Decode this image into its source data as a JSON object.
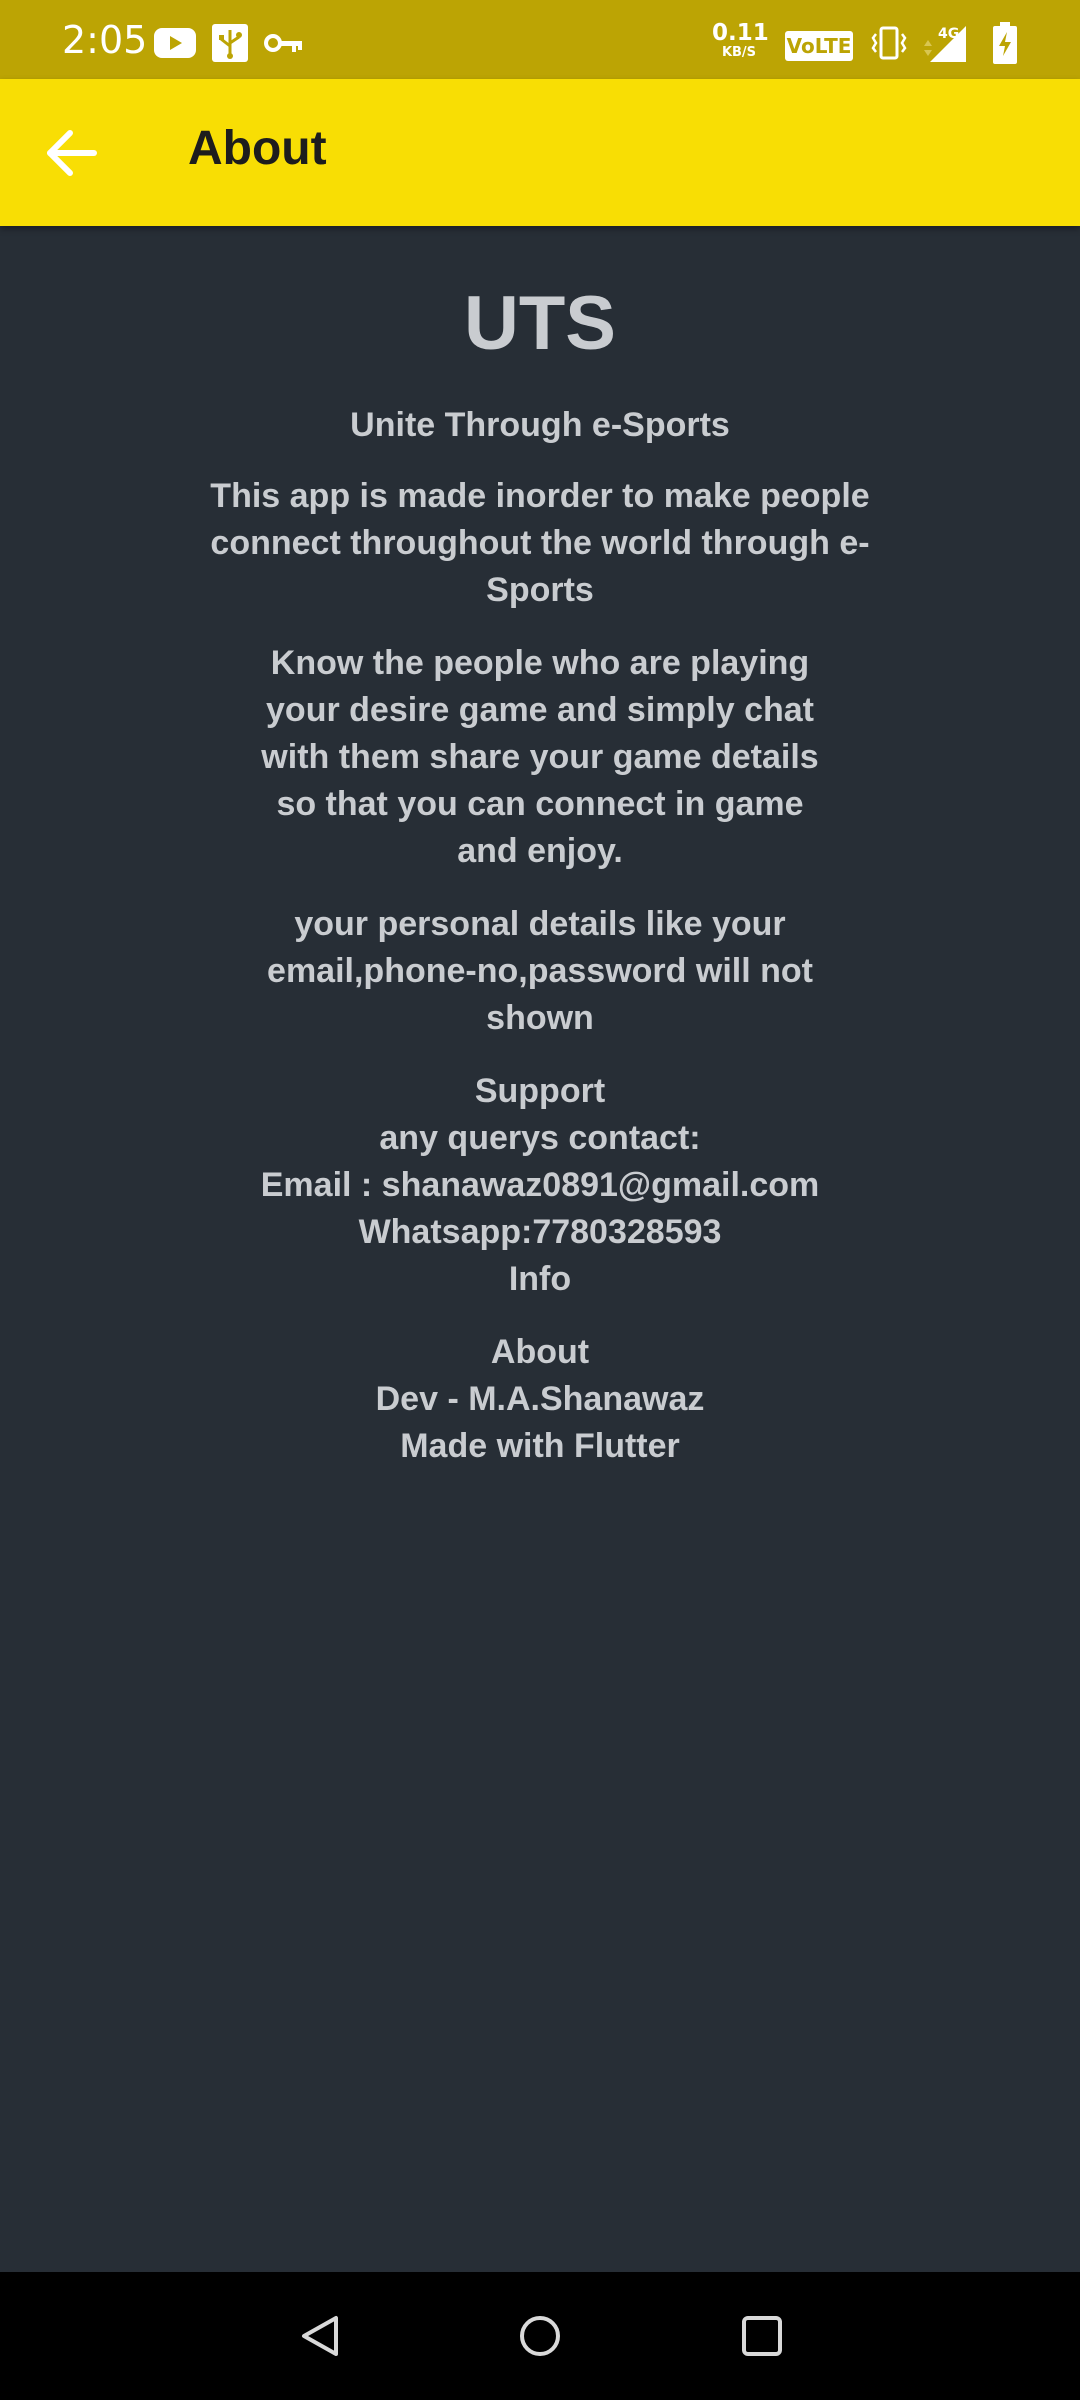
{
  "status_bar": {
    "time": "2:05",
    "net_speed_value": "0.11",
    "net_speed_unit": "KB/S",
    "volte": "VoLTE",
    "network": "4G",
    "icons": [
      "youtube-icon",
      "usb-icon",
      "vpn-key-icon",
      "vibrate-icon",
      "signal-icon",
      "battery-charging-icon"
    ]
  },
  "app_bar": {
    "title": "About",
    "back_icon": "arrow-back-icon"
  },
  "content": {
    "app_name": "UTS",
    "tagline": "Unite Through e-Sports",
    "paragraph1": "This app is made inorder to make people connect throughout the world through e-Sports",
    "paragraph2": "Know the people who are playing your desire game and simply chat with them share your game details so that you can connect in game and enjoy.",
    "paragraph3": "your personal details like your email,phone-no,password will not shown",
    "support": {
      "heading": "Support",
      "contact_label": "any querys contact:",
      "email": "Email : shanawaz0891@gmail.com",
      "whatsapp": "Whatsapp:7780328593",
      "info": "Info"
    },
    "about": {
      "heading": "About",
      "developer": "Dev - M.A.Shanawaz",
      "made_with": "Made with Flutter"
    }
  },
  "colors": {
    "status_bar": "#bca404",
    "app_bar": "#f8de04",
    "background": "#272e36",
    "text": "#c9ccd0",
    "nav_bar": "#000000"
  },
  "nav_bar": {
    "buttons": [
      "back-triangle-icon",
      "home-circle-icon",
      "recents-square-icon"
    ]
  }
}
